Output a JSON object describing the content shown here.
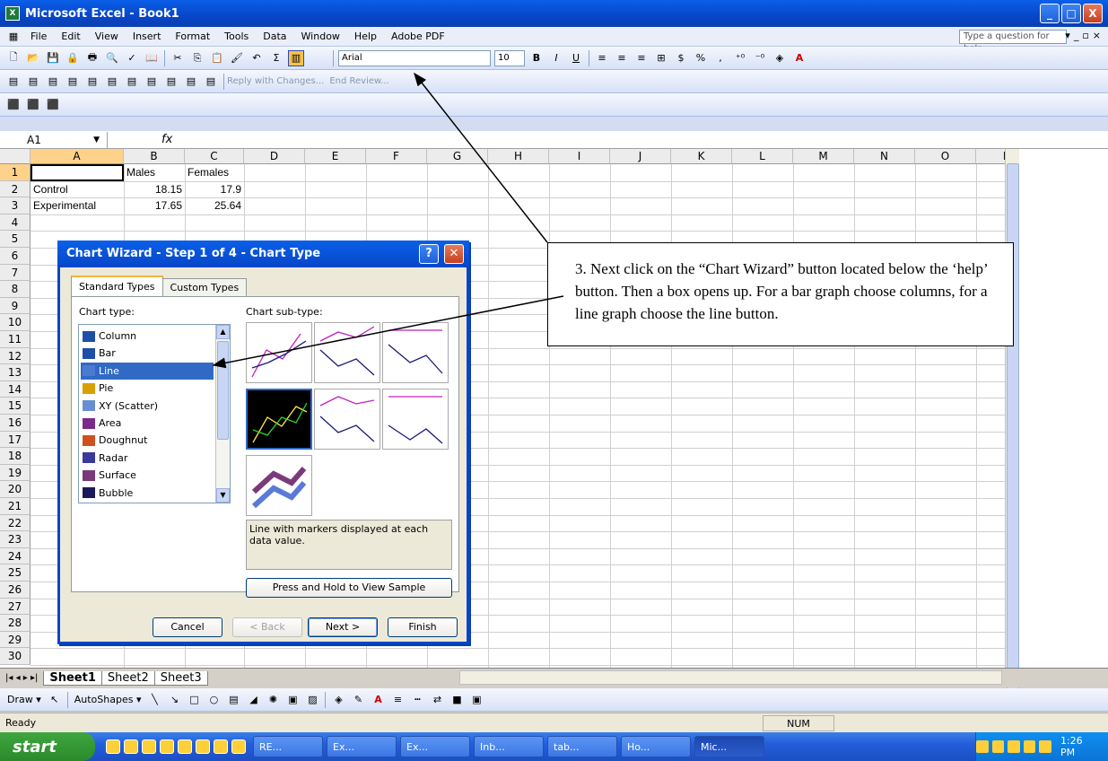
{
  "window": {
    "title": "Microsoft Excel - Book1",
    "min": "_",
    "max": "□",
    "close": "X"
  },
  "menu": {
    "items": [
      "File",
      "Edit",
      "View",
      "Insert",
      "Format",
      "Tools",
      "Data",
      "Window",
      "Help",
      "Adobe PDF"
    ],
    "help_placeholder": "Type a question for help"
  },
  "toolbar": {
    "font": "Arial",
    "size": "10",
    "reply_text": "Reply with Changes...",
    "review_text": "End Review..."
  },
  "formula": {
    "namebox": "A1",
    "fx": "fx"
  },
  "grid": {
    "columns": [
      "A",
      "B",
      "C",
      "D",
      "E",
      "F",
      "G",
      "H",
      "I",
      "J",
      "K",
      "L",
      "M",
      "N",
      "O",
      "P"
    ],
    "rows": [
      "1",
      "2",
      "3",
      "4",
      "5",
      "6",
      "7",
      "8",
      "9",
      "10",
      "11",
      "12",
      "13",
      "14",
      "15",
      "16",
      "17",
      "18",
      "19",
      "20",
      "21",
      "22",
      "23",
      "24",
      "25",
      "26",
      "27",
      "28",
      "29",
      "30"
    ],
    "cells": {
      "B1": "Males",
      "C1": "Females",
      "A2": "Control",
      "B2": "18.15",
      "C2": "17.9",
      "A3": "Experimental",
      "B3": "17.65",
      "C3": "25.64"
    }
  },
  "sheets": [
    "Sheet1",
    "Sheet2",
    "Sheet3"
  ],
  "draw": {
    "draw": "Draw ▾",
    "autoshapes": "AutoShapes ▾"
  },
  "status": {
    "ready": "Ready",
    "num": "NUM"
  },
  "taskbar": {
    "start": "start",
    "tasks": [
      "RE...",
      "Ex...",
      "Ex...",
      "Inb...",
      "tab...",
      "Ho...",
      "Mic..."
    ],
    "clock": "1:26 PM"
  },
  "dialog": {
    "title": "Chart Wizard - Step 1 of 4 - Chart Type",
    "tabs": [
      "Standard Types",
      "Custom Types"
    ],
    "chart_type_label": "Chart type:",
    "subtype_label": "Chart sub-type:",
    "types": [
      "Column",
      "Bar",
      "Line",
      "Pie",
      "XY (Scatter)",
      "Area",
      "Doughnut",
      "Radar",
      "Surface",
      "Bubble"
    ],
    "selected_type": "Line",
    "description": "Line with markers displayed at each data value.",
    "press_hold": "Press and Hold to View Sample",
    "buttons": {
      "cancel": "Cancel",
      "back": "< Back",
      "next": "Next >",
      "finish": "Finish"
    }
  },
  "callout": {
    "text": "3. Next click on the “Chart Wizard” button located below the ‘help’ button. Then a box opens up. For a bar graph choose columns, for a line graph choose the line button."
  }
}
